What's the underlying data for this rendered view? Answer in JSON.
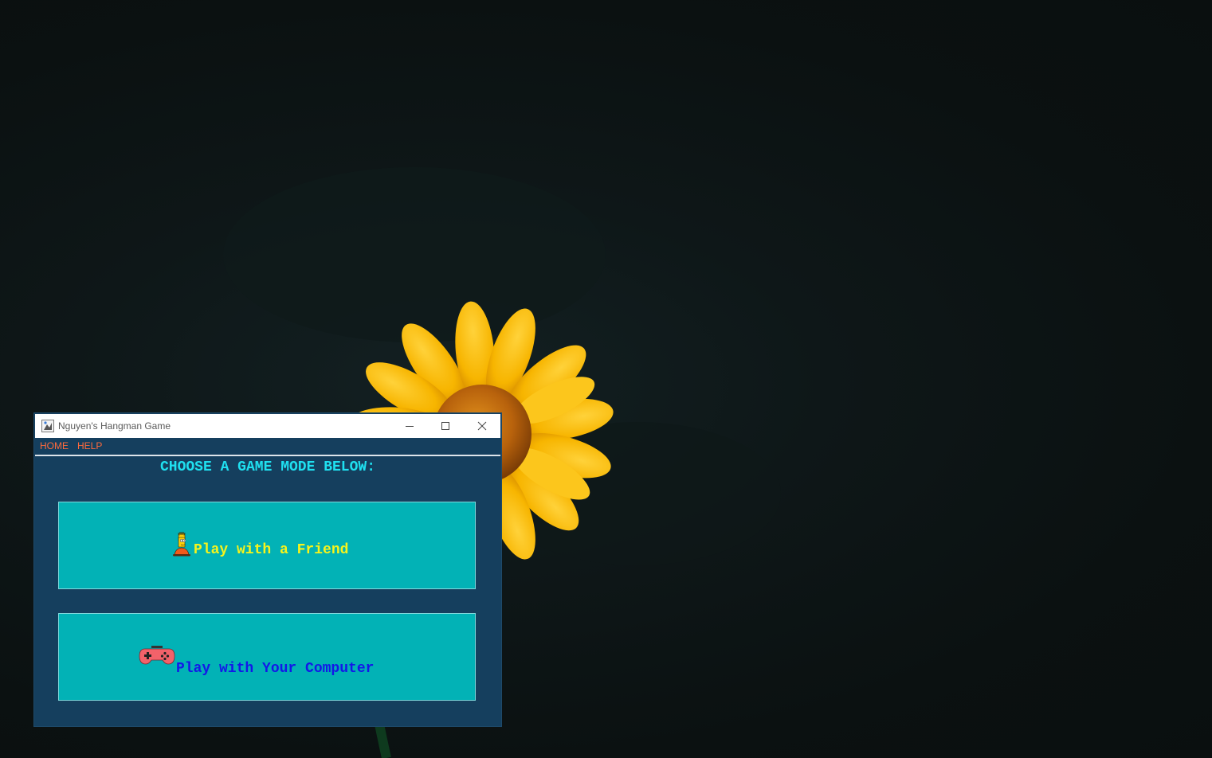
{
  "window": {
    "title": "Nguyen's Hangman Game"
  },
  "menu": {
    "items": [
      "HOME",
      "HELP"
    ]
  },
  "main": {
    "heading": "CHOOSE A GAME MODE BELOW:",
    "buttons": [
      {
        "label": "Play with a Friend",
        "icon": "bart-simpson-icon"
      },
      {
        "label": "Play with Your Computer",
        "icon": "gamepad-icon"
      }
    ]
  },
  "colors": {
    "window_bg": "#153f5e",
    "menu_text": "#ff6a3c",
    "heading_text": "#1fe0f0",
    "button_bg": "#02b2b6",
    "friend_label": "#f8f41a",
    "computer_label": "#1417e8"
  }
}
